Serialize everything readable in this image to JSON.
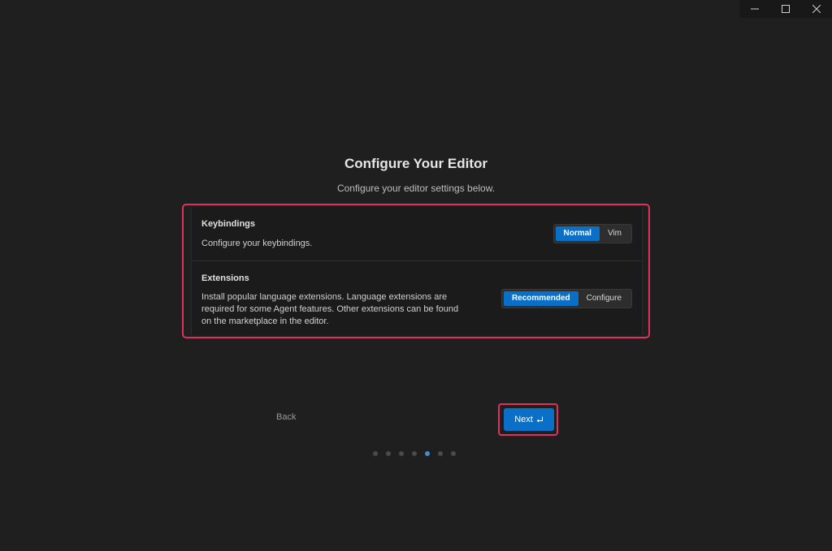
{
  "window_controls": {
    "minimize": "minimize-icon",
    "maximize": "maximize-icon",
    "close": "close-icon"
  },
  "header": {
    "title": "Configure Your Editor",
    "subtitle": "Configure your editor settings below."
  },
  "settings": {
    "keybindings": {
      "title": "Keybindings",
      "description": "Configure your keybindings.",
      "options": [
        "Normal",
        "Vim"
      ],
      "selected": "Normal"
    },
    "extensions": {
      "title": "Extensions",
      "description": "Install popular language extensions. Language extensions are required for some Agent features. Other extensions can be found on the marketplace in the editor.",
      "options": [
        "Recommended",
        "Configure"
      ],
      "selected": "Recommended"
    }
  },
  "footer": {
    "back_label": "Back",
    "next_label": "Next",
    "next_icon": "enter-icon"
  },
  "pager": {
    "total_steps": 7,
    "current_step": 5
  },
  "colors": {
    "background": "#1f1f1f",
    "accent": "#0a6fc7",
    "highlight": "#e0305e"
  }
}
